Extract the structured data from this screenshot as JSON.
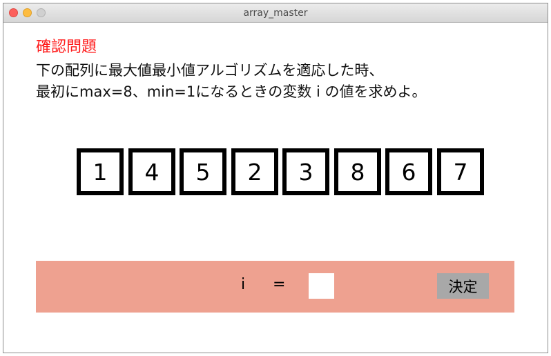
{
  "window": {
    "title": "array_master"
  },
  "question": {
    "heading": "確認問題",
    "line1": "下の配列に最大値最小値アルゴリズムを適応した時、",
    "line2": "最初にmax=8、min=1になるときの変数 i の値を求めよ。"
  },
  "array": {
    "values": [
      "1",
      "4",
      "5",
      "2",
      "3",
      "8",
      "6",
      "7"
    ]
  },
  "answer": {
    "variable_label": "i",
    "equals_label": "=",
    "input_value": "",
    "submit_label": "決定"
  },
  "colors": {
    "heading": "#ff1a1a",
    "answer_bar": "#eea190",
    "submit_button": "#a8a8a8"
  }
}
